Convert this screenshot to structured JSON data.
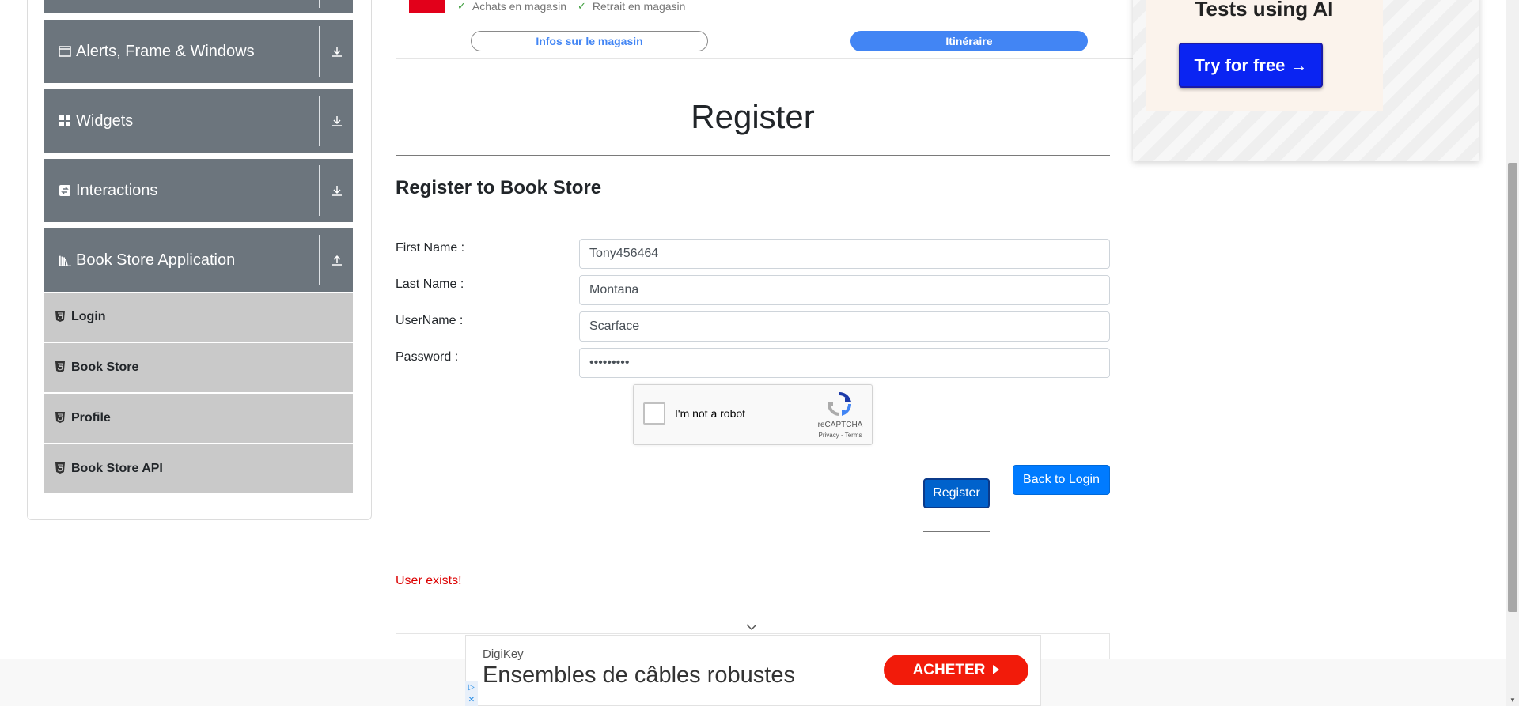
{
  "sidebar": {
    "groups": [
      {
        "label": "Alerts, Frame & Windows",
        "icon": "window-icon",
        "expanded": false
      },
      {
        "label": "Widgets",
        "icon": "widgets-icon",
        "expanded": false
      },
      {
        "label": "Interactions",
        "icon": "interactions-icon",
        "expanded": false
      },
      {
        "label": "Book Store Application",
        "icon": "books-icon",
        "expanded": true
      }
    ],
    "items": [
      {
        "label": "Login",
        "icon": "html5-icon"
      },
      {
        "label": "Book Store",
        "icon": "html5-icon"
      },
      {
        "label": "Profile",
        "icon": "html5-icon"
      },
      {
        "label": "Book Store API",
        "icon": "html5-icon"
      }
    ]
  },
  "store_ad": {
    "features": [
      "Achats en magasin",
      "Retrait en magasin"
    ],
    "info_button": "Infos sur le magasin",
    "route_button": "Itinéraire"
  },
  "right_ad": {
    "title": "Tests using AI",
    "cta": "Try for free →"
  },
  "form": {
    "page_title": "Register",
    "heading": "Register to Book Store",
    "fields": [
      {
        "label": "First Name :",
        "value": "Tony456464"
      },
      {
        "label": "Last Name :",
        "value": "Montana"
      },
      {
        "label": "UserName :",
        "value": "Scarface"
      },
      {
        "label": "Password :",
        "value": "•••••••••"
      }
    ],
    "captcha": {
      "label": "I'm not a robot",
      "brand": "reCAPTCHA",
      "links": "Privacy - Terms"
    },
    "register_button": "Register",
    "back_button": "Back to Login",
    "error": "User exists!"
  },
  "bottom_ad": {
    "brand": "DigiKey",
    "headline": "Ensembles de câbles robustes",
    "cta": "ACHETER"
  },
  "colors": {
    "sidebar_header": "#6c757d",
    "sidebar_item": "#c9c9c9",
    "primary": "#007bff",
    "error": "#dc0000",
    "ad_cta": "#f21b0a"
  }
}
